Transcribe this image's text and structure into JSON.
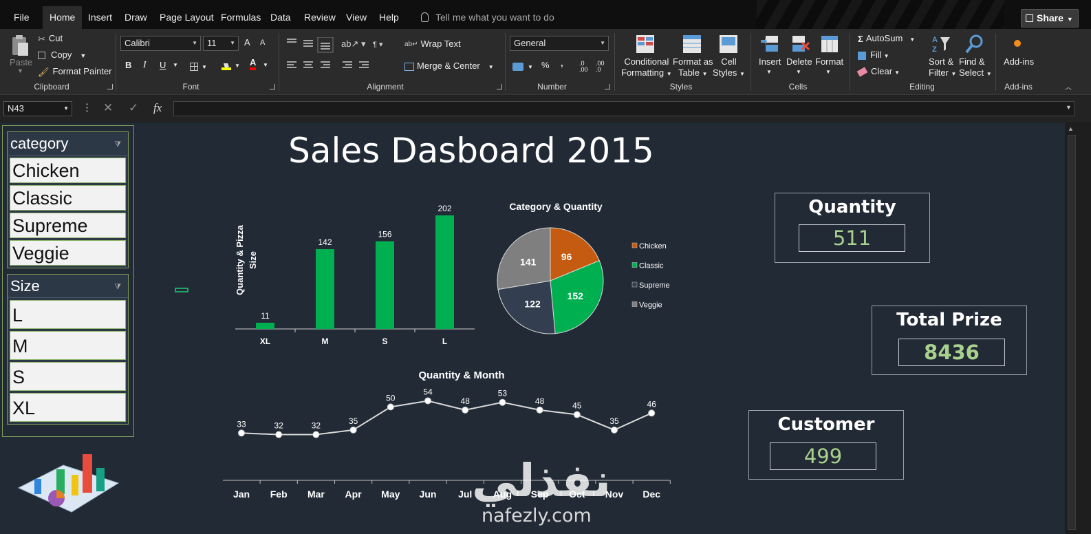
{
  "tabs": [
    "File",
    "Home",
    "Insert",
    "Draw",
    "Page Layout",
    "Formulas",
    "Data",
    "Review",
    "View",
    "Help"
  ],
  "tell_me": "Tell me what you want to do",
  "share": "Share",
  "ribbon": {
    "clipboard": {
      "paste": "Paste",
      "cut": "Cut",
      "copy": "Copy",
      "format_painter": "Format Painter",
      "label": "Clipboard"
    },
    "font": {
      "name": "Calibri",
      "size": "11",
      "label": "Font",
      "bold": "B",
      "italic": "I",
      "underline": "U",
      "grow": "A",
      "shrink": "A",
      "font_color": "A"
    },
    "alignment": {
      "wrap": "Wrap Text",
      "merge": "Merge & Center",
      "label": "Alignment"
    },
    "number": {
      "format": "General",
      "percent": "%",
      "comma": ",",
      "label": "Number"
    },
    "styles": {
      "conditional": [
        "Conditional",
        "Formatting"
      ],
      "format_table": [
        "Format as",
        "Table"
      ],
      "cell_styles": [
        "Cell",
        "Styles"
      ],
      "label": "Styles"
    },
    "cells": {
      "insert": "Insert",
      "delete": "Delete",
      "format": "Format",
      "label": "Cells"
    },
    "editing": {
      "autosum": "AutoSum",
      "fill": "Fill",
      "clear": "Clear",
      "sort": [
        "Sort &",
        "Filter"
      ],
      "find": [
        "Find &",
        "Select"
      ],
      "label": "Editing"
    },
    "addins": {
      "addins": "Add-ins",
      "label": "Add-ins"
    }
  },
  "formula_bar": {
    "name_box": "N43",
    "fx": "fx",
    "value": ""
  },
  "dashboard": {
    "title": "Sales Dasboard 2015",
    "slicers": [
      {
        "title": "category",
        "items": [
          "Chicken",
          "Classic",
          "Supreme",
          "Veggie"
        ]
      },
      {
        "title": "Size",
        "items": [
          "L",
          "M",
          "S",
          "XL"
        ]
      }
    ],
    "kpis": [
      {
        "label": "Quantity",
        "value": "511"
      },
      {
        "label": "Total Prize",
        "value": "8436"
      },
      {
        "label": "Customer",
        "value": "499"
      }
    ],
    "watermark": {
      "arabic": "نفذلي",
      "latin": "nafezly.com"
    }
  },
  "colors": {
    "bar": "#00b050",
    "chicken": "#c55a11",
    "classic": "#00b050",
    "supreme": "#333f50",
    "veggie": "#7f7f7f",
    "kpi_value": "#a9d18e",
    "sheet_bg": "#222a35"
  },
  "chart_data": [
    {
      "type": "bar",
      "title": "",
      "ylabel": "Quantity & Pizza Size",
      "xlabel": "",
      "categories": [
        "XL",
        "M",
        "S",
        "L"
      ],
      "values": [
        11,
        142,
        156,
        202
      ],
      "ylim": [
        0,
        202
      ],
      "grid": false,
      "legend": "none"
    },
    {
      "type": "pie",
      "title": "Category & Quantity",
      "categories": [
        "Chicken",
        "Classic",
        "Supreme",
        "Veggie"
      ],
      "values": [
        96,
        152,
        122,
        141
      ],
      "legend": "right"
    },
    {
      "type": "line",
      "title": "Quantity &  Month",
      "categories": [
        "Jan",
        "Feb",
        "Mar",
        "Apr",
        "May",
        "Jun",
        "Jul",
        "Aug",
        "Sep",
        "Oct",
        "Nov",
        "Dec"
      ],
      "values": [
        33,
        32,
        32,
        35,
        50,
        54,
        48,
        53,
        48,
        45,
        35,
        46
      ],
      "grid": false,
      "legend": "none"
    }
  ]
}
